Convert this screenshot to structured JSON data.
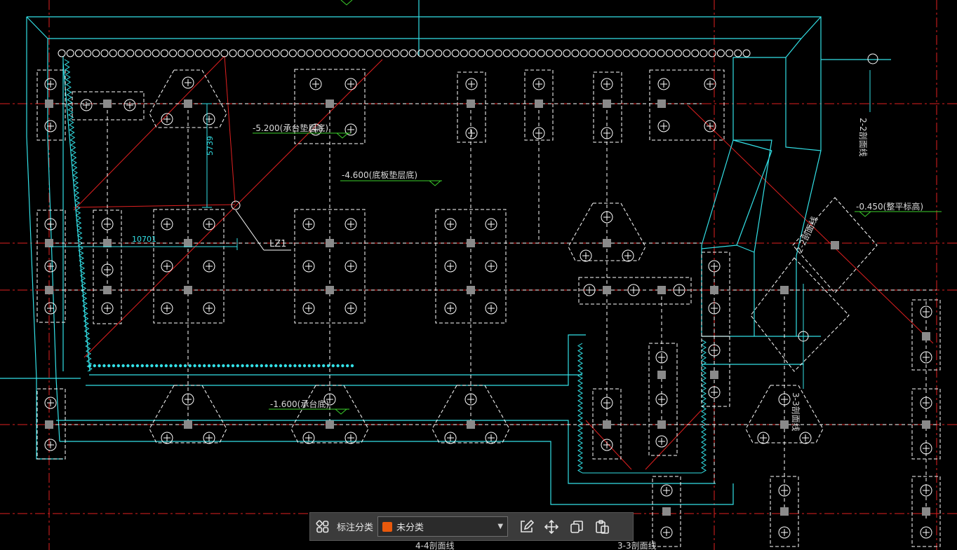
{
  "colors": {
    "background": "#000000",
    "wall": "#33e0e6",
    "pile_cap": "#ffffff",
    "axis": "#e02020",
    "level_mark": "#3cd02c",
    "accent_swatch": "#e8590c"
  },
  "annotations": {
    "level_cap_cushion": "-5.200(承台垫层底)",
    "level_slab_cushion": "-4.600(底板垫层底)",
    "level_cap_bottom": "-1.600(承台底)",
    "level_ground": "-0.450(整平标高)",
    "dim_vertical": "5739",
    "dim_horizontal": "10701",
    "column_label": "LZ1",
    "section_2_2_top": "2-2剖面线",
    "section_2_2_diag": "2-2剖面线",
    "section_3_3": "3-3剖面线",
    "section_4_4_bottom": "4-4剖面线",
    "section_3_3_bottom": "3-3剖面线"
  },
  "toolbar": {
    "grid_icon": "grid-icon",
    "category_label": "标注分类",
    "category_value": "未分类",
    "icons": [
      "edit-icon",
      "move-icon",
      "copy-icon",
      "paste-icon"
    ]
  }
}
